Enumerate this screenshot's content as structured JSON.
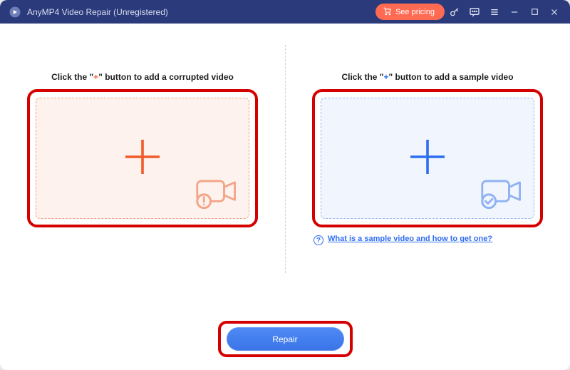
{
  "titlebar": {
    "title": "AnyMP4 Video Repair (Unregistered)",
    "pricing_label": "See pricing"
  },
  "left": {
    "instruction_pre": "Click the \"",
    "instruction_plus": "+",
    "instruction_post": "\" button to add a corrupted video"
  },
  "right": {
    "instruction_pre": "Click the \"",
    "instruction_plus": "+",
    "instruction_post": "\" button to add a sample video",
    "help_link": "What is a sample video and how to get one?"
  },
  "footer": {
    "repair_label": "Repair"
  }
}
